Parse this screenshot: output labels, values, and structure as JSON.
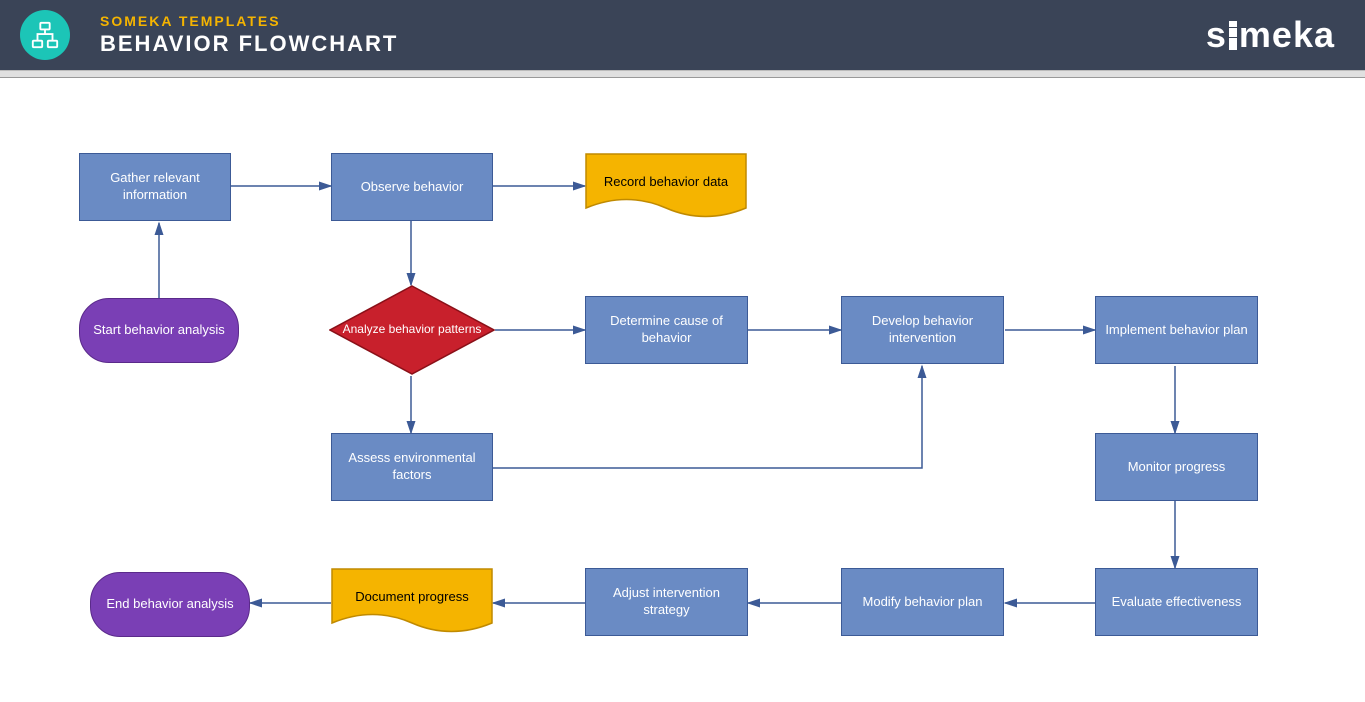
{
  "header": {
    "subtitle": "SOMEKA TEMPLATES",
    "title": "BEHAVIOR FLOWCHART",
    "brand": "someka"
  },
  "nodes": {
    "start": "Start behavior analysis",
    "gather": "Gather relevant information",
    "observe": "Observe behavior",
    "record": "Record behavior data",
    "analyze": "Analyze behavior patterns",
    "determine": "Determine cause of behavior",
    "develop": "Develop behavior intervention",
    "implement": "Implement behavior plan",
    "assess": "Assess environmental factors",
    "monitor": "Monitor progress",
    "evaluate": "Evaluate effectiveness",
    "modify": "Modify behavior plan",
    "adjust": "Adjust intervention strategy",
    "document": "Document progress",
    "end": "End behavior analysis"
  },
  "chart_data": {
    "type": "flowchart",
    "title": "Behavior Flowchart",
    "nodes": [
      {
        "id": "start",
        "type": "terminator",
        "label": "Start behavior analysis"
      },
      {
        "id": "gather",
        "type": "process",
        "label": "Gather relevant information"
      },
      {
        "id": "observe",
        "type": "process",
        "label": "Observe behavior"
      },
      {
        "id": "record",
        "type": "document",
        "label": "Record behavior data"
      },
      {
        "id": "analyze",
        "type": "decision",
        "label": "Analyze behavior patterns"
      },
      {
        "id": "determine",
        "type": "process",
        "label": "Determine cause of behavior"
      },
      {
        "id": "develop",
        "type": "process",
        "label": "Develop behavior intervention"
      },
      {
        "id": "implement",
        "type": "process",
        "label": "Implement behavior plan"
      },
      {
        "id": "assess",
        "type": "process",
        "label": "Assess environmental factors"
      },
      {
        "id": "monitor",
        "type": "process",
        "label": "Monitor progress"
      },
      {
        "id": "evaluate",
        "type": "process",
        "label": "Evaluate effectiveness"
      },
      {
        "id": "modify",
        "type": "process",
        "label": "Modify behavior plan"
      },
      {
        "id": "adjust",
        "type": "process",
        "label": "Adjust intervention strategy"
      },
      {
        "id": "document",
        "type": "document",
        "label": "Document progress"
      },
      {
        "id": "end",
        "type": "terminator",
        "label": "End behavior analysis"
      }
    ],
    "edges": [
      {
        "from": "start",
        "to": "gather"
      },
      {
        "from": "gather",
        "to": "observe"
      },
      {
        "from": "observe",
        "to": "record"
      },
      {
        "from": "observe",
        "to": "analyze"
      },
      {
        "from": "analyze",
        "to": "determine"
      },
      {
        "from": "analyze",
        "to": "assess"
      },
      {
        "from": "determine",
        "to": "develop"
      },
      {
        "from": "assess",
        "to": "develop"
      },
      {
        "from": "develop",
        "to": "implement"
      },
      {
        "from": "implement",
        "to": "monitor"
      },
      {
        "from": "monitor",
        "to": "evaluate"
      },
      {
        "from": "evaluate",
        "to": "modify"
      },
      {
        "from": "modify",
        "to": "adjust"
      },
      {
        "from": "adjust",
        "to": "document"
      },
      {
        "from": "document",
        "to": "end"
      }
    ]
  }
}
